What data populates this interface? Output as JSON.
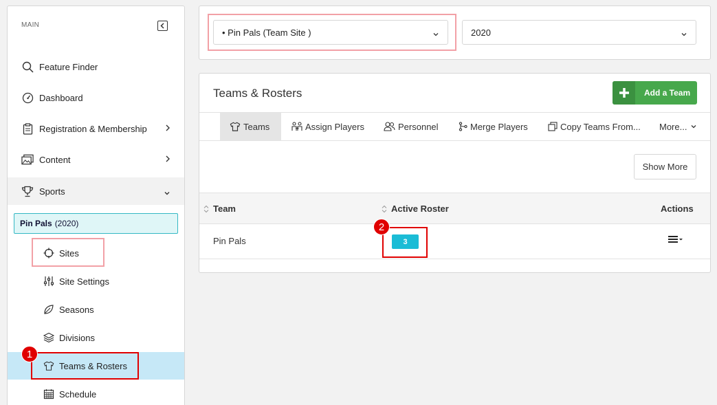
{
  "sidebar": {
    "section_label": "MAIN",
    "items": [
      {
        "label": "Feature Finder",
        "icon": "search-icon"
      },
      {
        "label": "Dashboard",
        "icon": "gauge-icon"
      },
      {
        "label": "Registration & Membership",
        "icon": "clipboard-icon"
      },
      {
        "label": "Content",
        "icon": "images-icon"
      },
      {
        "label": "Sports",
        "icon": "trophy-icon"
      }
    ],
    "org": {
      "name": "Pin Pals",
      "season": "(2020)"
    },
    "sub_items": [
      {
        "label": "Sites",
        "icon": "crosshair-icon"
      },
      {
        "label": "Site Settings",
        "icon": "sliders-icon"
      },
      {
        "label": "Seasons",
        "icon": "leaf-icon"
      },
      {
        "label": "Divisions",
        "icon": "layers-icon"
      },
      {
        "label": "Teams & Rosters",
        "icon": "shirt-icon"
      },
      {
        "label": "Schedule",
        "icon": "calendar-icon"
      }
    ]
  },
  "selectors": {
    "site": "• Pin Pals (Team Site )",
    "season": "2020"
  },
  "panel": {
    "title": "Teams & Rosters",
    "add_button": "Add a Team",
    "show_more": "Show More",
    "tabs": [
      {
        "label": "Teams",
        "icon": "shirt-icon"
      },
      {
        "label": "Assign Players",
        "icon": "people-icon"
      },
      {
        "label": "Personnel",
        "icon": "users-icon"
      },
      {
        "label": "Merge Players",
        "icon": "merge-icon"
      },
      {
        "label": "Copy Teams From...",
        "icon": "copy-icon"
      },
      {
        "label": "More...",
        "icon": "chevron-down-icon"
      }
    ],
    "columns": {
      "team": "Team",
      "roster": "Active Roster",
      "actions": "Actions"
    },
    "rows": [
      {
        "team": "Pin Pals",
        "roster": "3"
      }
    ]
  },
  "annotations": {
    "step1": "1",
    "step2": "2"
  },
  "colors": {
    "highlight_pink": "#f2a0a6",
    "highlight_red": "#e00000",
    "add_green": "#47a84c",
    "badge_cyan": "#1bbcd6",
    "active_blue": "#c6e8f7"
  }
}
